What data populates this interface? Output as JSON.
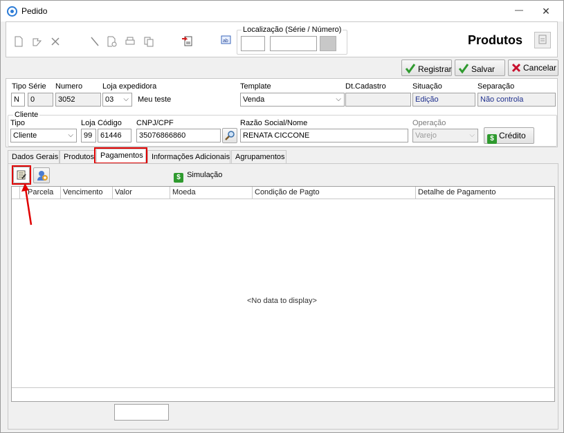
{
  "window": {
    "title": "Pedido",
    "close_glyph": "✕",
    "minimize_glyph": "—"
  },
  "localizacao": {
    "label": "Localização (Série / Número)"
  },
  "header": {
    "title": "Produtos"
  },
  "actions": {
    "registrar": "Registrar",
    "salvar": "Salvar",
    "cancelar": "Cancelar"
  },
  "labels": {
    "tipo": "Tipo",
    "serie": "Série",
    "numero": "Numero",
    "loja_expedidora": "Loja expedidora",
    "template": "Template",
    "dt_cadastro": "Dt.Cadastro",
    "situacao": "Situação",
    "separacao": "Separação",
    "cliente_group": "Cliente",
    "cliente_tipo": "Tipo",
    "loja": "Loja",
    "codigo": "Código",
    "cnpj": "CNPJ/CPF",
    "razao": "Razão Social/Nome",
    "operacao": "Operação"
  },
  "values": {
    "tipo": "N",
    "serie": "0",
    "numero": "3052",
    "loja_expedidora": "03",
    "loja_expedidora_nome": "Meu teste",
    "template": "Venda",
    "dt_cadastro": "",
    "situacao": "Edição",
    "separacao": "Não controla",
    "cliente_tipo": "Cliente",
    "loja": "99",
    "codigo": "61446",
    "cnpj": "35076866860",
    "razao": "RENATA CICCONE",
    "operacao": "Varejo"
  },
  "credito_button": "Crédito",
  "tabs": [
    {
      "label": "Dados Gerais"
    },
    {
      "label": "Produtos"
    },
    {
      "label": "Pagamentos"
    },
    {
      "label": "Informações Adicionais"
    },
    {
      "label": "Agrupamentos"
    }
  ],
  "simulacao_button": "Simulação",
  "grid": {
    "columns": [
      "Parcela",
      "Vencimento",
      "Valor",
      "Moeda",
      "Condição de Pagto",
      "Detalhe de Pagamento"
    ],
    "empty_text": "<No data to display>"
  },
  "colors": {
    "highlight": "#e00000",
    "accent_green": "#2f9a2f",
    "accent_red": "#c8102e"
  }
}
